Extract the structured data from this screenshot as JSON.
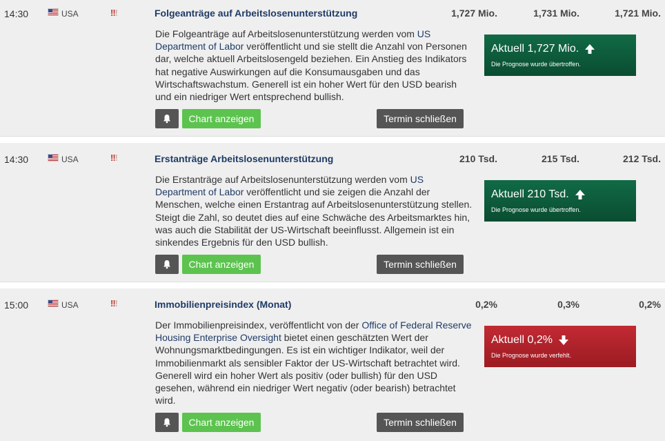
{
  "colors": {
    "beat": "#0a4d31",
    "miss": "#9c1b22",
    "link": "#1f3b66",
    "chart_button": "#5cc34f"
  },
  "buttons": {
    "chart": "Chart anzeigen",
    "close": "Termin schließen"
  },
  "impact_icon": "!!!",
  "events": [
    {
      "time": "14:30",
      "country": "USA",
      "title": "Folgeanträge auf Arbeitslosenunterstützung",
      "actual_value": "1,727 Mio.",
      "forecast": "1,731 Mio.",
      "previous": "1,721 Mio.",
      "desc_pre": "Die Folgeanträge auf Arbeitslosenunterstützung werden vom ",
      "desc_link": "US Department of Labor",
      "desc_post": " veröffentlicht und sie stellt die Anzahl von Personen dar, welche aktuell Arbeitslosengeld beziehen. Ein Anstieg des Indikators hat negative Auswirkungen auf die Konsumausgaben und das Wirtschaftswachstum. Generell ist ein hoher Wert für den USD bearish und ein niedriger Wert entsprechend bullish.",
      "actual_label": "Aktuell 1,727 Mio.",
      "actual_note": "Die Prognose wurde übertroffen.",
      "direction": "up"
    },
    {
      "time": "14:30",
      "country": "USA",
      "title": "Erstanträge Arbeitslosenunterstützung",
      "actual_value": "210 Tsd.",
      "forecast": "215 Tsd.",
      "previous": "212 Tsd.",
      "desc_pre": "Die Erstanträge auf Arbeitslosenunterstützung werden vom ",
      "desc_link": "US Department of Labor",
      "desc_post": " veröffentlicht und sie zeigen die Anzahl der Menschen, welche einen Erstantrag auf Arbeitslosenunterstützung stellen. Steigt die Zahl, so deutet dies auf eine Schwäche des Arbeitsmarktes hin, was auch die Stabilität der US-Wirtschaft beeinflusst. Allgemein ist ein sinkendes Ergebnis für den USD bullish.",
      "actual_label": "Aktuell 210 Tsd.",
      "actual_note": "Die Prognose wurde übertroffen.",
      "direction": "up"
    },
    {
      "time": "15:00",
      "country": "USA",
      "title": "Immobilienpreisindex (Monat)",
      "actual_value": "0,2%",
      "forecast": "0,3%",
      "previous": "0,2%",
      "desc_pre": "Der Immobilienpreisindex, veröffentlicht von der ",
      "desc_link": "Office of Federal Reserve Housing Enterprise Oversight",
      "desc_post": " bietet einen geschätzten Wert der Wohnungsmarktbedingungen. Es ist ein wichtiger Indikator, weil der Immobilienmarkt als sensibler Faktor der US-Wirtschaft betrachtet wird. Generell wird ein hoher Wert als positiv (oder bullish) für den USD gesehen, während ein niedriger Wert negativ (oder bearish) betrachtet wird.",
      "actual_label": "Aktuell 0,2%",
      "actual_note": "Die Prognose wurde verfehlt.",
      "direction": "down"
    }
  ]
}
